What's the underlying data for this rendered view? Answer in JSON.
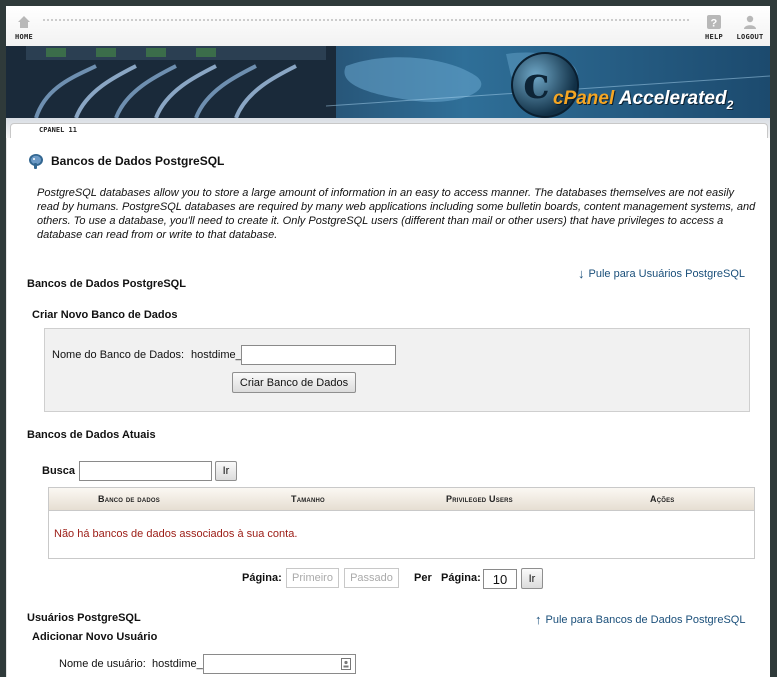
{
  "nav": {
    "home_label": "HOME",
    "help_label": "HELP",
    "logout_label": "LOGOUT"
  },
  "brand": {
    "c_letter": "c",
    "name_prefix": "cPanel",
    "name_suffix": " Accelerated",
    "version": "2"
  },
  "breadcrumb": {
    "label": "CPANEL 11"
  },
  "page": {
    "title": "Bancos de Dados PostgreSQL",
    "description": "PostgreSQL databases allow you to store a large amount of information in an easy to access manner. The databases themselves are not easily read by humans. PostgreSQL databases are required by many web applications including some bulletin boards, content management systems, and others. To use a database, you'll need to create it. Only PostgreSQL users (different than mail or other users) that have privileges to access a database can read from or write to that database."
  },
  "databases": {
    "heading": "Bancos de Dados PostgreSQL",
    "jump_link": "Pule para Usuários PostgreSQL",
    "create": {
      "heading": "Criar Novo Banco de Dados",
      "name_label": "Nome do Banco de Dados:",
      "prefix": "hostdime_",
      "name_value": "",
      "submit_label": "Criar Banco de Dados"
    },
    "current": {
      "heading": "Bancos de Dados Atuais",
      "search_label": "Busca",
      "search_value": "",
      "search_button": "Ir",
      "columns": [
        "Banco de dados",
        "Tamanho",
        "Privileged Users",
        "Ações"
      ],
      "empty_message": "Não há bancos de dados associados à sua conta."
    },
    "pager": {
      "page_label": "Página:",
      "first_label": "Primeiro",
      "prev_label": "Passado",
      "per_label": "Per",
      "per_page_label": "Página:",
      "per_page_value": "10",
      "go_label": "Ir"
    }
  },
  "users": {
    "heading": "Usuários PostgreSQL",
    "jump_link": "Pule para Bancos de Dados PostgreSQL",
    "add": {
      "heading": "Adicionar Novo Usuário",
      "username_label": "Nome de usuário:",
      "prefix": "hostdime_",
      "username_value": ""
    }
  }
}
